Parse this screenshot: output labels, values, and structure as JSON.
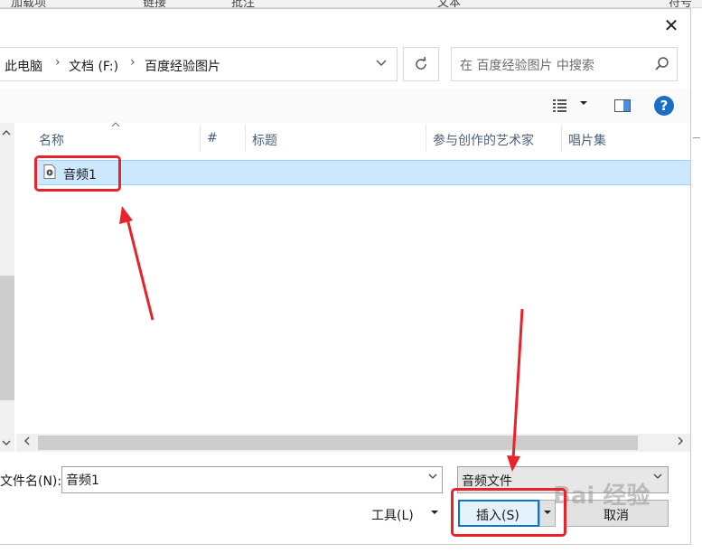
{
  "ribbon": {
    "items": [
      "加载项",
      "链接",
      "批注",
      "文本",
      "符号"
    ]
  },
  "dialog": {
    "close_label": "✕",
    "breadcrumbs": [
      "此电脑",
      "文档 (F:)",
      "百度经验图片"
    ],
    "crumb_separator": "›",
    "search_placeholder": "在 百度经验图片 中搜索",
    "help_label": "?",
    "columns": [
      "名称",
      "#",
      "标题",
      "参与创作的艺术家",
      "唱片集"
    ],
    "files": [
      {
        "name": "音频1",
        "icon": "audio-file-icon"
      }
    ],
    "filename_label": "文件名(N):",
    "filename_value": "音频1",
    "filetype_value": "音频文件",
    "tools_label": "工具(L)",
    "insert_label": "插入(S)",
    "cancel_label": "取消"
  },
  "watermark": {
    "text": "Bai 经验"
  },
  "colors": {
    "selection": "#cce8ff",
    "accent": "#0078d7",
    "annotation": "#e8242a",
    "help": "#1b6ec2"
  }
}
